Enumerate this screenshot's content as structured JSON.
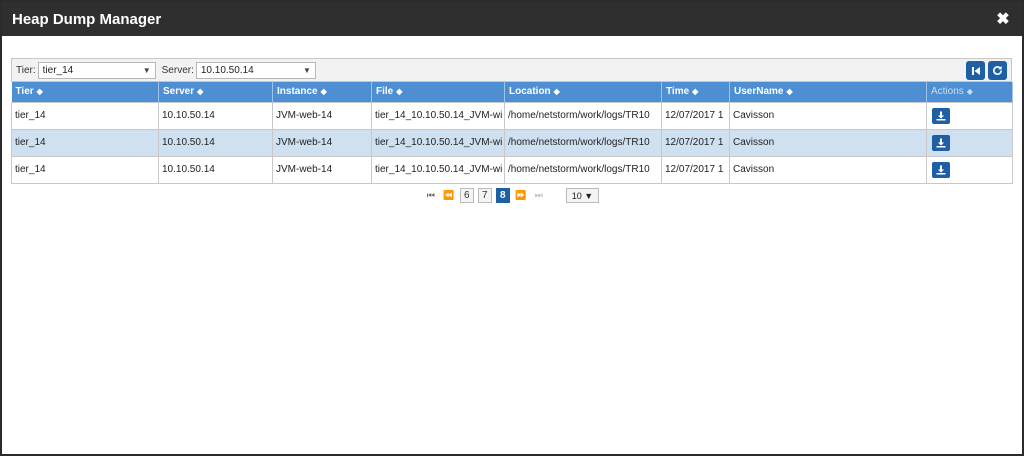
{
  "dialog": {
    "title": "Heap Dump Manager",
    "close_icon": "close-icon"
  },
  "filters": {
    "tier_label": "Tier:",
    "tier_value": "tier_14",
    "server_label": "Server:",
    "server_value": "10.10.50.14"
  },
  "toolbar": {
    "first_icon": "skip-first-icon",
    "refresh_icon": "refresh-icon"
  },
  "table": {
    "columns": [
      "Tier",
      "Server",
      "Instance",
      "File",
      "Location",
      "Time",
      "UserName",
      "Actions"
    ],
    "rows": [
      [
        "tier_14",
        "10.10.50.14",
        "JVM-web-14",
        "tier_14_10.10.50.14_JVM-wi",
        "/home/netstorm/work/logs/TR10",
        "12/07/2017 1",
        "Cavisson"
      ],
      [
        "tier_14",
        "10.10.50.14",
        "JVM-web-14",
        "tier_14_10.10.50.14_JVM-wi",
        "/home/netstorm/work/logs/TR10",
        "12/07/2017 1",
        "Cavisson"
      ],
      [
        "tier_14",
        "10.10.50.14",
        "JVM-web-14",
        "tier_14_10.10.50.14_JVM-wi",
        "/home/netstorm/work/logs/TR10",
        "12/07/2017 1",
        "Cavisson"
      ]
    ],
    "row_action_icon": "download-icon"
  },
  "pagination": {
    "pages": [
      "6",
      "7",
      "8"
    ],
    "current": "8",
    "page_size": "10 ▼"
  },
  "colors": {
    "header": "#4d8fd2",
    "button": "#1f5fa3",
    "alt_row": "#cfe0f1",
    "titlebar": "#2f2f2f"
  }
}
